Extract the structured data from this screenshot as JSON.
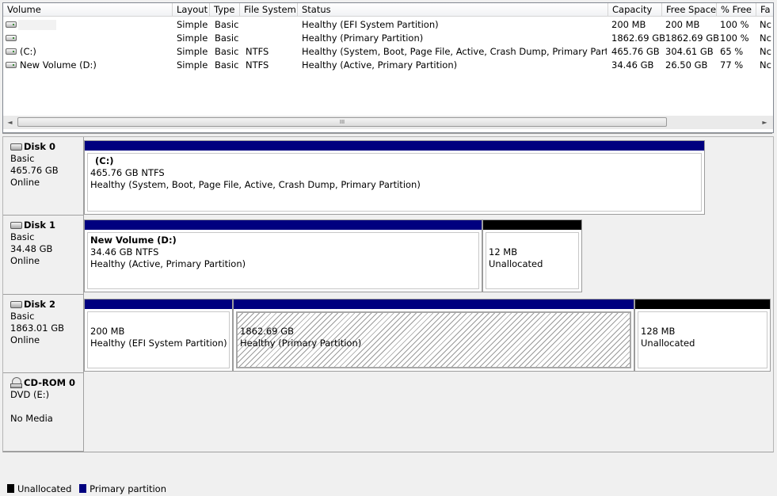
{
  "volume_list": {
    "columns": [
      "Volume",
      "Layout",
      "Type",
      "File System",
      "Status",
      "Capacity",
      "Free Space",
      "% Free",
      "Fa"
    ],
    "rows": [
      {
        "volume": "",
        "layout": "Simple",
        "type": "Basic",
        "fs": "",
        "status": "Healthy (EFI System Partition)",
        "capacity": "200 MB",
        "free": "200 MB",
        "pct": "100 %",
        "fault": "Nc",
        "icon": "drive-icon"
      },
      {
        "volume": "",
        "layout": "Simple",
        "type": "Basic",
        "fs": "",
        "status": "Healthy (Primary Partition)",
        "capacity": "1862.69 GB",
        "free": "1862.69 GB",
        "pct": "100 %",
        "fault": "Nc",
        "icon": "drive-icon"
      },
      {
        "volume": "(C:)",
        "layout": "Simple",
        "type": "Basic",
        "fs": "NTFS",
        "status": "Healthy (System, Boot, Page File, Active, Crash Dump, Primary Partitio...",
        "capacity": "465.76 GB",
        "free": "304.61 GB",
        "pct": "65 %",
        "fault": "Nc",
        "icon": "drive-icon"
      },
      {
        "volume": "New Volume (D:)",
        "layout": "Simple",
        "type": "Basic",
        "fs": "NTFS",
        "status": "Healthy (Active, Primary Partition)",
        "capacity": "34.46 GB",
        "free": "26.50 GB",
        "pct": "77 %",
        "fault": "Nc",
        "icon": "drive-icon"
      }
    ],
    "scroll_left": "◄",
    "scroll_right": "►",
    "scroll_grip": "III"
  },
  "disks": [
    {
      "name": "Disk 0",
      "type": "Basic",
      "size": "465.76 GB",
      "status": "Online",
      "icon": "hard-disk-icon",
      "partitions": [
        {
          "label": "(C:)",
          "size": "465.76 GB NTFS",
          "status": "Healthy (System, Boot, Page File, Active, Crash Dump, Primary Partition)",
          "kind": "primary"
        }
      ]
    },
    {
      "name": "Disk 1",
      "type": "Basic",
      "size": "34.48 GB",
      "status": "Online",
      "icon": "hard-disk-icon",
      "partitions": [
        {
          "label": "New Volume  (D:)",
          "size": "34.46 GB NTFS",
          "status": "Healthy (Active, Primary Partition)",
          "kind": "primary"
        },
        {
          "label": "",
          "size": "12 MB",
          "status": "Unallocated",
          "kind": "unallocated"
        }
      ]
    },
    {
      "name": "Disk 2",
      "type": "Basic",
      "size": "1863.01 GB",
      "status": "Online",
      "icon": "hard-disk-icon",
      "partitions": [
        {
          "label": "",
          "size": "200 MB",
          "status": "Healthy (EFI System Partition)",
          "kind": "primary"
        },
        {
          "label": "",
          "size": "1862.69 GB",
          "status": "Healthy (Primary Partition)",
          "kind": "primary",
          "selected": true
        },
        {
          "label": "",
          "size": "128 MB",
          "status": "Unallocated",
          "kind": "unallocated"
        }
      ]
    },
    {
      "name": "CD-ROM 0",
      "type": "DVD (E:)",
      "size": "",
      "status": "No Media",
      "icon": "cdrom-icon"
    }
  ],
  "legend": [
    {
      "label": "Unallocated",
      "color": "#000000"
    },
    {
      "label": "Primary partition",
      "color": "#00007f"
    }
  ]
}
